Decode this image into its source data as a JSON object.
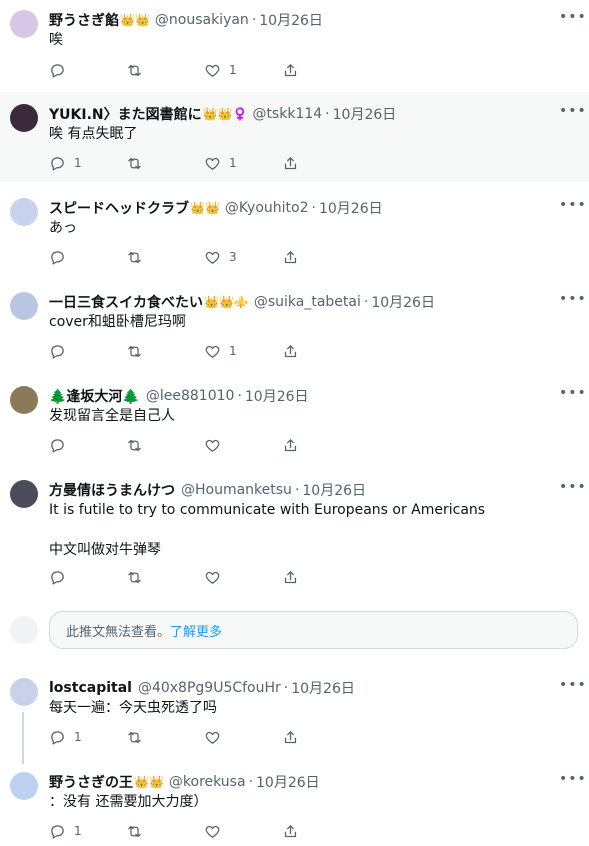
{
  "tweets": [
    {
      "name": "野うさぎ餡",
      "emoji": "👑👑",
      "handle": "@nousakiyan",
      "date": "10月26日",
      "text": "唉",
      "reply": "",
      "rt": "",
      "like": "1",
      "avatar_color": "#d8c6e6"
    },
    {
      "name": "YUKI.N〉また図書館に",
      "emoji": "👑👑♀️",
      "handle": "@tskk114",
      "date": "10月26日",
      "text": "唉 有点失眠了",
      "reply": "1",
      "rt": "",
      "like": "1",
      "avatar_color": "#3a2a3a"
    },
    {
      "name": "スピードヘッドクラブ",
      "emoji": "👑👑",
      "handle": "@Kyouhito2",
      "date": "10月26日",
      "text": "あっ",
      "reply": "",
      "rt": "",
      "like": "3",
      "avatar_color": "#c7d3ec"
    },
    {
      "name": "一日三食スイカ食べたい",
      "emoji": "👑👑⚜️",
      "handle": "@suika_tabetai",
      "date": "10月26日",
      "text": "cover和蛆卧槽尼玛啊",
      "reply": "",
      "rt": "",
      "like": "1",
      "avatar_color": "#b9c8e2"
    },
    {
      "name": "🌲逢坂大河🌲",
      "emoji": "",
      "handle": "@lee881010",
      "date": "10月26日",
      "text": "发现留言全是自己人",
      "reply": "",
      "rt": "",
      "like": "",
      "avatar_color": "#8a7a5a"
    },
    {
      "name": "方曼倩ほうまんけつ",
      "emoji": "",
      "handle": "@Houmanketsu",
      "date": "10月26日",
      "text": "It is futile to try to communicate with Europeans or Americans\n\n中文叫做对牛弹琴",
      "reply": "",
      "rt": "",
      "like": "",
      "avatar_color": "#4a4c5a"
    },
    {
      "name": "lostcapital",
      "emoji": "",
      "handle": "@40x8Pg9U5CfouHr",
      "date": "10月26日",
      "text": "每天一遍：今天虫死透了吗",
      "reply": "1",
      "rt": "",
      "like": "",
      "avatar_color": "#c8d2e8"
    },
    {
      "name": "野うさぎの王",
      "emoji": "👑👑",
      "handle": "@korekusa",
      "date": "10月26日",
      "text": "：没有 还需要加大力度）",
      "reply": "1",
      "rt": "",
      "like": "",
      "avatar_color": "#bcd0f0"
    }
  ],
  "unavailable": {
    "text": "此推文無法查看。",
    "link": "了解更多"
  },
  "more_glyph": "•••",
  "icons": {
    "reply": "reply-icon",
    "retweet": "retweet-icon",
    "like": "heart-icon",
    "share": "share-icon"
  }
}
